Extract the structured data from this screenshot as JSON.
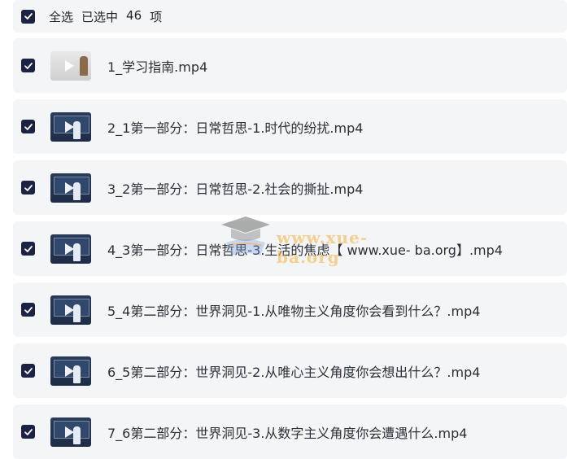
{
  "header": {
    "select_all": "全选",
    "selected_label": "已选中",
    "selected_count": "46",
    "unit": "项"
  },
  "files": [
    {
      "name": "1_学习指南.mp4",
      "thumbnail": "light-cover"
    },
    {
      "name": "2_1第一部分：日常哲思-1.时代的纷扰.mp4",
      "thumbnail": "lecture"
    },
    {
      "name": "3_2第一部分：日常哲思-2.社会的撕扯.mp4",
      "thumbnail": "lecture"
    },
    {
      "name": "4_3第一部分：日常哲思-3.生活的焦虑【 www.xue- ba.org】.mp4",
      "thumbnail": "lecture"
    },
    {
      "name": "5_4第二部分：世界洞见-1.从唯物主义角度你会看到什么？.mp4",
      "thumbnail": "lecture"
    },
    {
      "name": "6_5第二部分：世界洞见-2.从唯心主义角度你会想出什么？.mp4",
      "thumbnail": "lecture"
    },
    {
      "name": "7_6第二部分：世界洞见-3.从数字主义角度你会遭遇什么.mp4",
      "thumbnail": "lecture"
    }
  ],
  "watermark": {
    "text": "www.xue-ba.org",
    "icon": "graduation-cap-icon"
  },
  "colors": {
    "checkbox": "#1c2244",
    "row_background": "#f4f5f7",
    "watermark": "#f5af3c"
  },
  "checkbox_state": "checked"
}
